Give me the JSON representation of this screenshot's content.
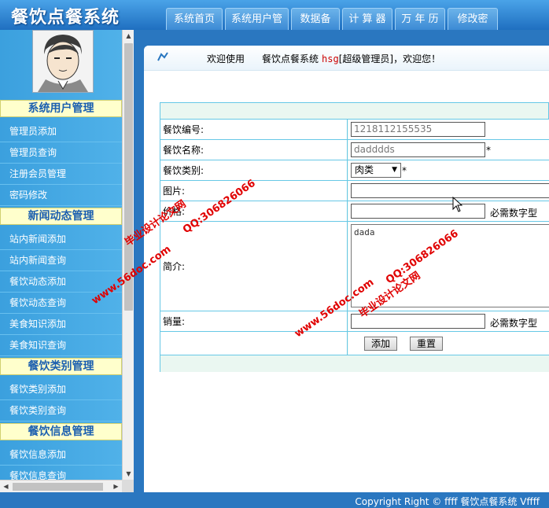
{
  "header": {
    "logo": "餐饮点餐系统",
    "nav": [
      "系统首页",
      "系统用户管理",
      "数据备份",
      "计 算 器",
      "万 年 历",
      "修改密码"
    ]
  },
  "sidebar": {
    "groups": [
      {
        "title": "系统用户管理",
        "items": [
          "管理员添加",
          "管理员查询",
          "注册会员管理",
          "密码修改"
        ]
      },
      {
        "title": "新闻动态管理",
        "items": [
          "站内新闻添加",
          "站内新闻查询",
          "餐饮动态添加",
          "餐饮动态查询",
          "美食知识添加",
          "美食知识查询"
        ]
      },
      {
        "title": "餐饮类别管理",
        "items": [
          "餐饮类别添加",
          "餐饮类别查询"
        ]
      },
      {
        "title": "餐饮信息管理",
        "items": [
          "餐饮信息添加",
          "餐饮信息查询"
        ]
      }
    ]
  },
  "welcome": {
    "greet": "欢迎使用",
    "system": "餐饮点餐系统",
    "user": "hsg",
    "role": "[超级管理员]，欢迎您！"
  },
  "form": {
    "code_label": "餐饮编号:",
    "code_value": "1218112155535",
    "name_label": "餐饮名称:",
    "name_value": "dadddds",
    "required_mark": "*",
    "category_label": "餐饮类别:",
    "category_value": "肉类",
    "image_label": "图片:",
    "image_value": "",
    "price_label": "价格:",
    "price_value": "",
    "number_hint": "必需数字型",
    "intro_label": "简介:",
    "intro_value": "dada",
    "sales_label": "销量:",
    "sales_value": "",
    "add_button": "添加",
    "reset_button": "重置"
  },
  "footer": {
    "copyright": "Copyright Right © ffff 餐饮点餐系统 Vffff"
  },
  "watermark": {
    "site": "www.56doc.com",
    "qq": "QQ:306826066",
    "slogan": "毕业设计论文网"
  }
}
